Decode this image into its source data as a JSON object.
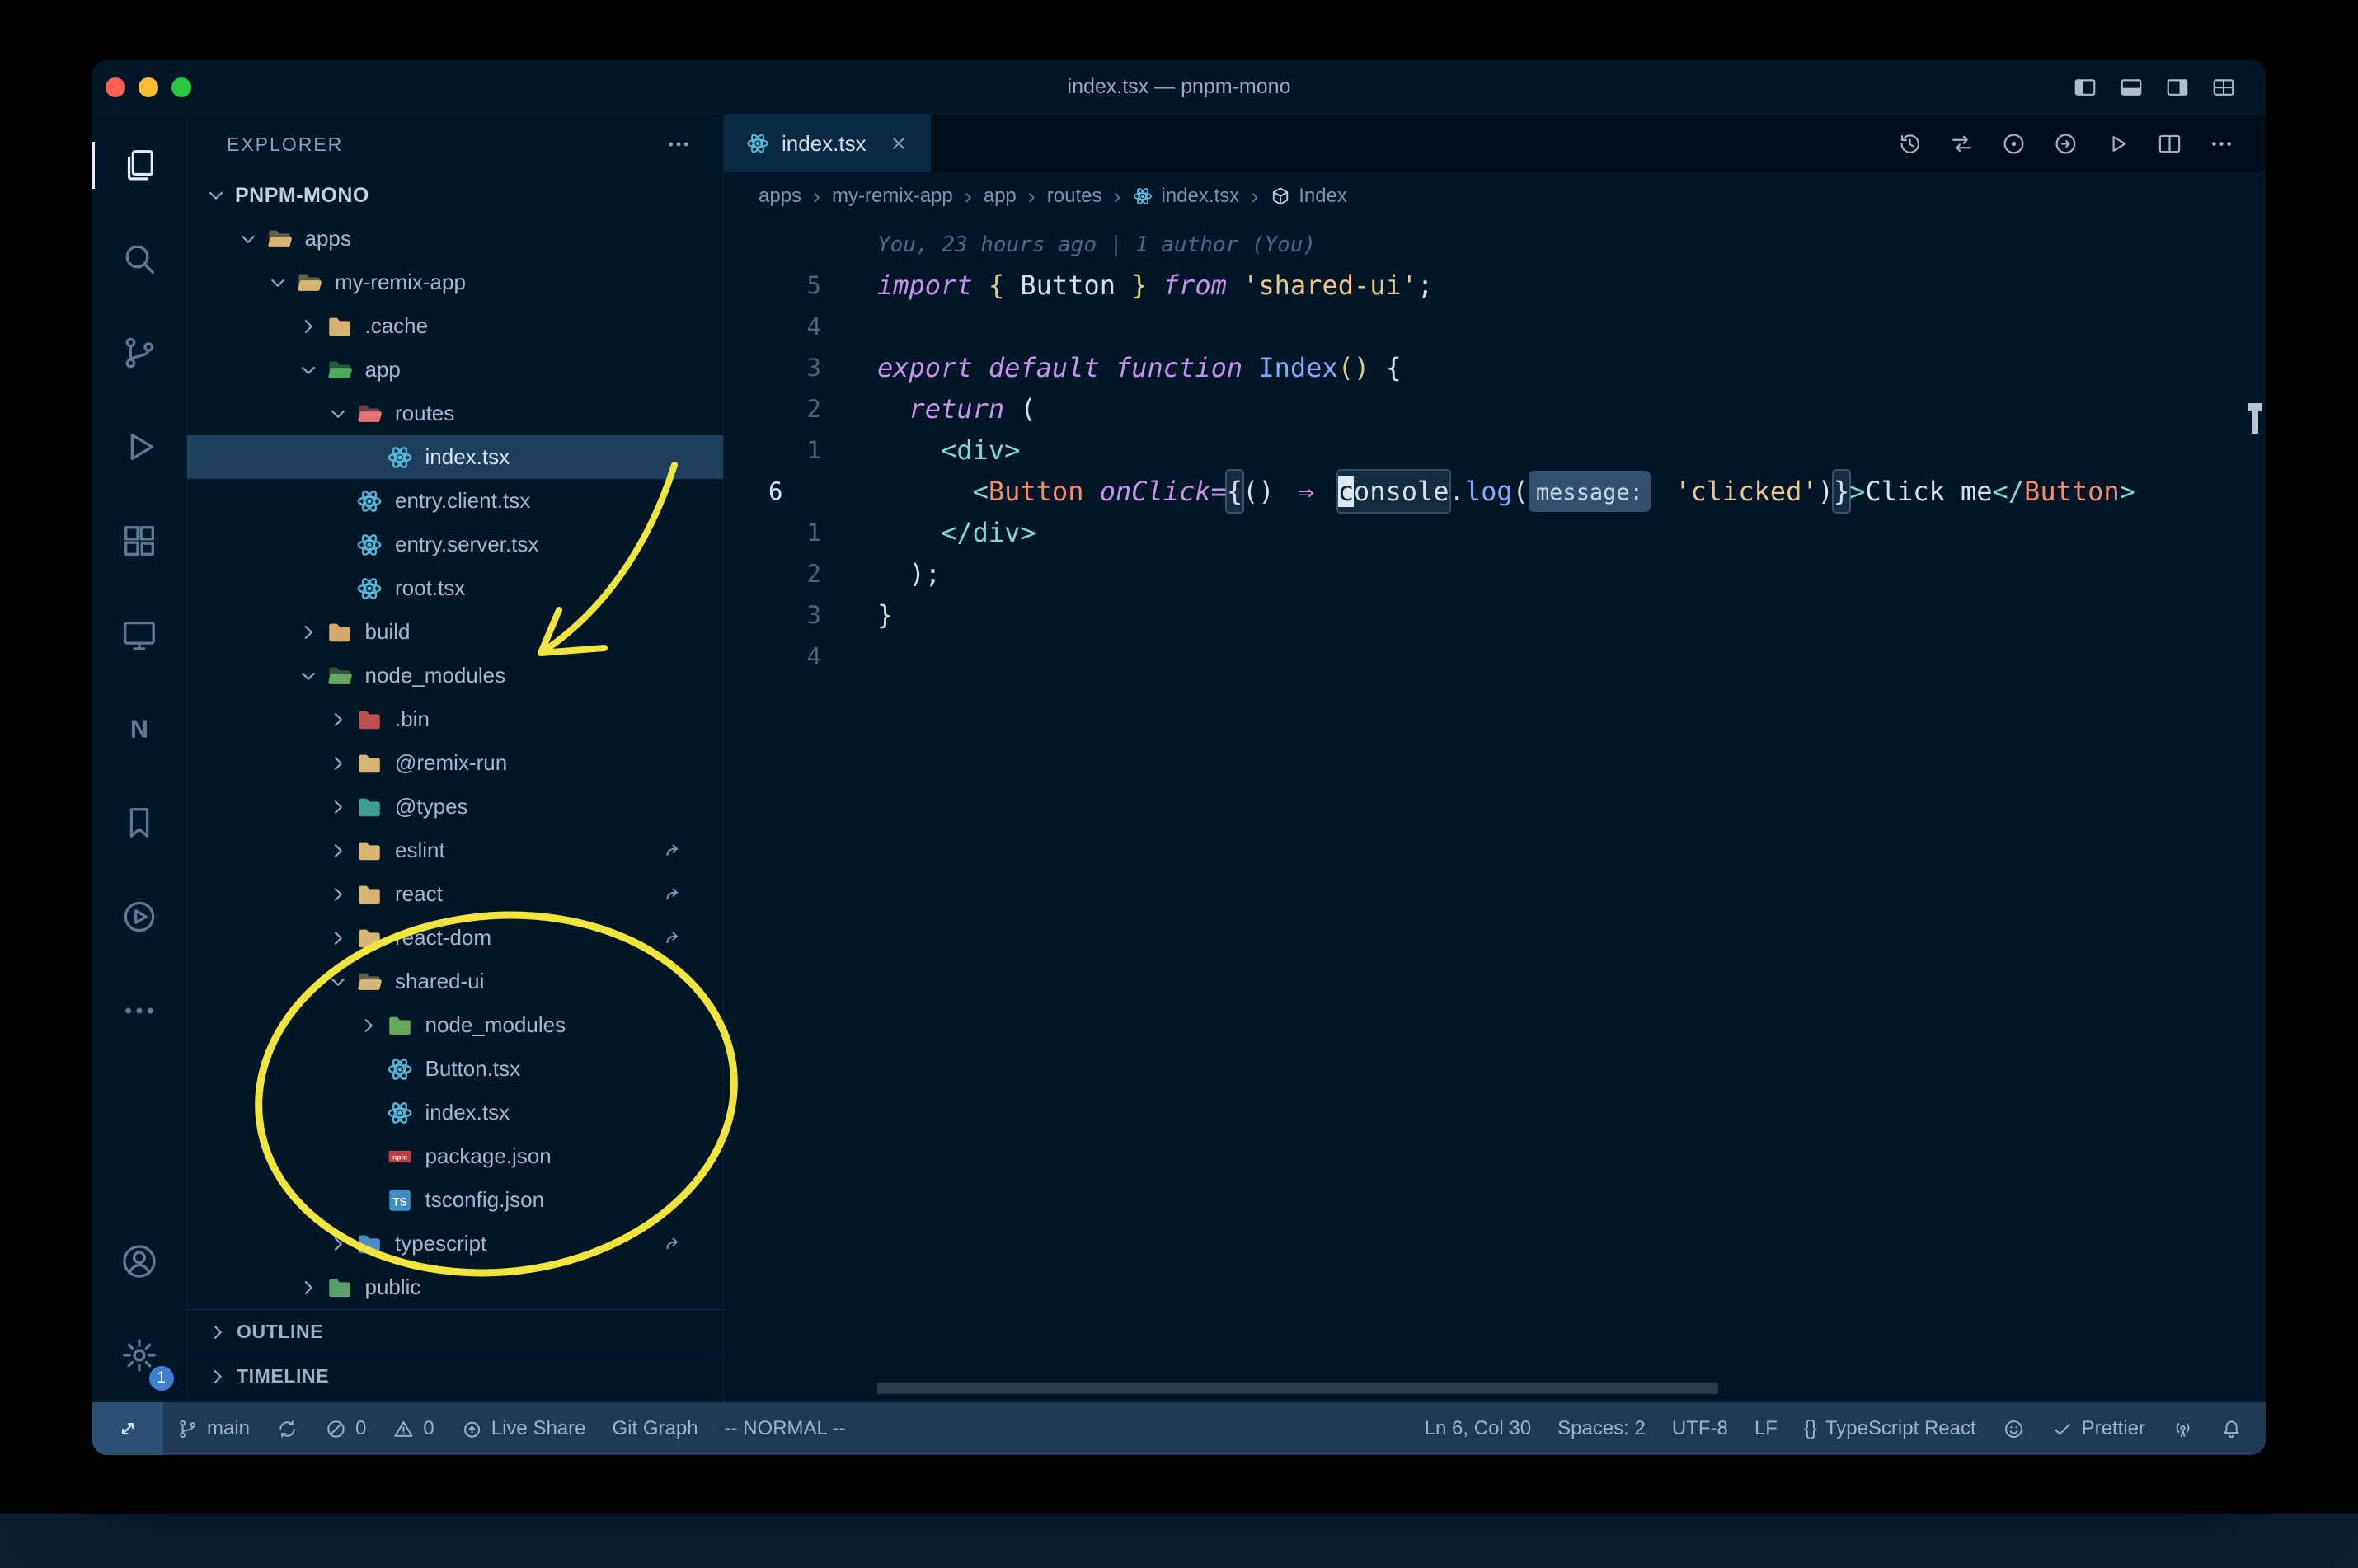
{
  "colors": {
    "yellow_annotation": "#f1e43c",
    "selection": "#1d3f5c",
    "statusbar_bg": "#1f3a55",
    "badge": "#3f7fd4",
    "react_icon": "#56b6d9"
  },
  "window": {
    "title": "index.tsx — pnpm-mono",
    "controls": [
      {
        "name": "close",
        "color": "#ff5f57"
      },
      {
        "name": "minimize",
        "color": "#febc2e"
      },
      {
        "name": "zoom",
        "color": "#28c840"
      }
    ]
  },
  "titlebar": {
    "layout_icons": [
      {
        "name": "toggle-primary-sidebar",
        "icon": "layout-left"
      },
      {
        "name": "toggle-panel",
        "icon": "layout-bottom"
      },
      {
        "name": "toggle-secondary-sidebar",
        "icon": "layout-right"
      },
      {
        "name": "customize-layout",
        "icon": "layout-grid"
      }
    ]
  },
  "activity_bar": {
    "top": [
      {
        "name": "explorer",
        "icon": "files",
        "active": true
      },
      {
        "name": "search",
        "icon": "search"
      },
      {
        "name": "source-control",
        "icon": "scm"
      },
      {
        "name": "run-and-debug",
        "icon": "debug"
      },
      {
        "name": "extensions",
        "icon": "extensions"
      },
      {
        "name": "remote-explorer",
        "icon": "monitor"
      },
      {
        "name": "nx-console",
        "icon": "nx"
      },
      {
        "name": "bookmarks",
        "icon": "bookmark"
      },
      {
        "name": "code-runner",
        "icon": "runner"
      },
      {
        "name": "additional-views",
        "icon": "more"
      }
    ],
    "bottom": [
      {
        "name": "accounts",
        "icon": "account"
      },
      {
        "name": "settings",
        "icon": "gear",
        "badge": "1"
      }
    ]
  },
  "sidebar": {
    "header": "EXPLORER",
    "root": "PNPM-MONO",
    "tree": [
      {
        "label": "apps",
        "level": 1,
        "chev": "down",
        "icon": "folder-open",
        "color": "#d8b573"
      },
      {
        "label": "my-remix-app",
        "level": 2,
        "chev": "down",
        "icon": "folder-open",
        "color": "#d8b573"
      },
      {
        "label": ".cache",
        "level": 3,
        "chev": "right",
        "icon": "folder",
        "color": "#d8b573"
      },
      {
        "label": "app",
        "level": 3,
        "chev": "down",
        "icon": "folder-open",
        "color": "#4fab5c"
      },
      {
        "label": "routes",
        "level": 4,
        "chev": "down",
        "icon": "folder-open",
        "color": "#e57373"
      },
      {
        "label": "index.tsx",
        "level": 5,
        "icon": "react",
        "selected": true
      },
      {
        "label": "entry.client.tsx",
        "level": 4,
        "icon": "react"
      },
      {
        "label": "entry.server.tsx",
        "level": 4,
        "icon": "react"
      },
      {
        "label": "root.tsx",
        "level": 4,
        "icon": "react"
      },
      {
        "label": "build",
        "level": 3,
        "chev": "right",
        "icon": "folder",
        "color": "#d8a86a"
      },
      {
        "label": "node_modules",
        "level": 3,
        "chev": "down",
        "icon": "folder-open",
        "color": "#66a95c"
      },
      {
        "label": ".bin",
        "level": 4,
        "chev": "right",
        "icon": "folder",
        "color": "#c05050"
      },
      {
        "label": "@remix-run",
        "level": 4,
        "chev": "right",
        "icon": "folder",
        "color": "#d8b573"
      },
      {
        "label": "@types",
        "level": 4,
        "chev": "right",
        "icon": "folder",
        "color": "#3e9e8f"
      },
      {
        "label": "eslint",
        "level": 4,
        "chev": "right",
        "icon": "folder",
        "color": "#d8b573",
        "symlink": true
      },
      {
        "label": "react",
        "level": 4,
        "chev": "right",
        "icon": "folder",
        "color": "#d8b573",
        "symlink": true
      },
      {
        "label": "react-dom",
        "level": 4,
        "chev": "right",
        "icon": "folder",
        "color": "#d8b573",
        "symlink": true
      },
      {
        "label": "shared-ui",
        "level": 4,
        "chev": "down",
        "icon": "folder-open",
        "color": "#d8b573"
      },
      {
        "label": "node_modules",
        "level": 5,
        "chev": "right",
        "icon": "folder",
        "color": "#66a95c"
      },
      {
        "label": "Button.tsx",
        "level": 5,
        "icon": "react"
      },
      {
        "label": "index.tsx",
        "level": 5,
        "icon": "react"
      },
      {
        "label": "package.json",
        "level": 5,
        "icon": "npm"
      },
      {
        "label": "tsconfig.json",
        "level": 5,
        "icon": "ts"
      },
      {
        "label": "typescript",
        "level": 4,
        "chev": "right",
        "icon": "folder",
        "color": "#4a8fc7",
        "symlink": true
      },
      {
        "label": "public",
        "level": 3,
        "chev": "right",
        "icon": "folder",
        "color": "#5aa06a"
      }
    ],
    "sections": [
      "OUTLINE",
      "TIMELINE"
    ]
  },
  "editor": {
    "tab": {
      "label": "index.tsx"
    },
    "actions": [
      {
        "name": "local-history",
        "icon": "history"
      },
      {
        "name": "open-changes",
        "icon": "compare"
      },
      {
        "name": "toggle-blame",
        "icon": "circle-dot"
      },
      {
        "name": "open-preview",
        "icon": "circle-arrow"
      },
      {
        "name": "run-file",
        "icon": "play"
      },
      {
        "name": "split-editor",
        "icon": "split"
      },
      {
        "name": "more-actions",
        "icon": "moreh"
      }
    ],
    "breadcrumbs": [
      {
        "label": "apps"
      },
      {
        "label": "my-remix-app"
      },
      {
        "label": "app"
      },
      {
        "label": "routes"
      },
      {
        "label": "index.tsx",
        "icon": "react"
      },
      {
        "label": "Index",
        "icon": "symbol"
      }
    ],
    "blame": "You, 23 hours ago | 1 author (You)",
    "lines": [
      {
        "num": "5",
        "tokens": [
          {
            "t": "import",
            "c": "kw"
          },
          {
            "t": " ",
            "c": "fg"
          },
          {
            "t": "{",
            "c": "gold"
          },
          {
            "t": " Button ",
            "c": "fg"
          },
          {
            "t": "}",
            "c": "gold"
          },
          {
            "t": " ",
            "c": "fg"
          },
          {
            "t": "from",
            "c": "kw"
          },
          {
            "t": " ",
            "c": "fg"
          },
          {
            "t": "'shared-ui'",
            "c": "str"
          },
          {
            "t": ";",
            "c": "fg"
          }
        ]
      },
      {
        "num": "4",
        "tokens": []
      },
      {
        "num": "3",
        "tokens": [
          {
            "t": "export",
            "c": "kw"
          },
          {
            "t": " ",
            "c": "fg"
          },
          {
            "t": "default",
            "c": "kw"
          },
          {
            "t": " ",
            "c": "fg"
          },
          {
            "t": "function",
            "c": "kw"
          },
          {
            "t": " ",
            "c": "fg"
          },
          {
            "t": "Index",
            "c": "fn"
          },
          {
            "t": "()",
            "c": "gold"
          },
          {
            "t": " {",
            "c": "fg"
          }
        ]
      },
      {
        "num": "2",
        "tokens": [
          {
            "t": "  ",
            "c": "fg"
          },
          {
            "t": "return",
            "c": "kw"
          },
          {
            "t": " (",
            "c": "fg"
          }
        ]
      },
      {
        "num": "1",
        "tokens": [
          {
            "t": "    ",
            "c": "fg"
          },
          {
            "t": "<div>",
            "c": "tag"
          }
        ]
      },
      {
        "num": "6",
        "cur": true,
        "tokens": [
          {
            "t": "      ",
            "c": "fg"
          },
          {
            "t": "<",
            "c": "tag"
          },
          {
            "t": "Button",
            "c": "cmp"
          },
          {
            "t": " ",
            "c": "fg"
          },
          {
            "t": "onClick",
            "c": "attr"
          },
          {
            "t": "=",
            "c": "kw"
          },
          {
            "t": "{",
            "c": "brk"
          },
          {
            "t": "()",
            "c": "fg"
          },
          {
            "t": " ",
            "c": "fg"
          },
          {
            "t": "⇒",
            "c": "lig"
          },
          {
            "t": " ",
            "c": "fg"
          },
          {
            "t": "console",
            "c": "whl",
            "cursor": 0
          },
          {
            "t": ".",
            "c": "fg"
          },
          {
            "t": "log",
            "c": "fn"
          },
          {
            "t": "(",
            "c": "fg"
          },
          {
            "t": "message:",
            "c": "inlay"
          },
          {
            "t": " ",
            "c": "fg"
          },
          {
            "t": "'clicked'",
            "c": "str"
          },
          {
            "t": ")",
            "c": "fg"
          },
          {
            "t": "}",
            "c": "brk"
          },
          {
            "t": ">",
            "c": "tag"
          },
          {
            "t": "Click me",
            "c": "fg"
          },
          {
            "t": "</",
            "c": "tag"
          },
          {
            "t": "Button",
            "c": "cmp"
          },
          {
            "t": ">",
            "c": "tag"
          }
        ]
      },
      {
        "num": "1",
        "tokens": [
          {
            "t": "    ",
            "c": "fg"
          },
          {
            "t": "</div>",
            "c": "tag"
          }
        ]
      },
      {
        "num": "2",
        "tokens": [
          {
            "t": "  ",
            "c": "fg"
          },
          {
            "t": ");",
            "c": "fg"
          }
        ]
      },
      {
        "num": "3",
        "tokens": [
          {
            "t": "}",
            "c": "fg"
          }
        ]
      },
      {
        "num": "4",
        "tokens": []
      }
    ]
  },
  "status_bar": {
    "left": [
      {
        "name": "remote",
        "icon": "remote",
        "box": true
      },
      {
        "name": "branch",
        "icon": "branch",
        "label": "main"
      },
      {
        "name": "sync",
        "icon": "sync"
      },
      {
        "name": "errors",
        "icon": "error",
        "label": "0"
      },
      {
        "name": "warnings",
        "icon": "warning",
        "label": "0"
      },
      {
        "name": "live-share",
        "icon": "liveshare",
        "label": "Live Share"
      },
      {
        "name": "git-graph",
        "label": "Git Graph"
      },
      {
        "name": "vim-mode",
        "label": "-- NORMAL --"
      }
    ],
    "right": [
      {
        "name": "cursor-position",
        "label": "Ln 6, Col 30"
      },
      {
        "name": "indentation",
        "label": "Spaces: 2"
      },
      {
        "name": "encoding",
        "label": "UTF-8"
      },
      {
        "name": "eol",
        "label": "LF"
      },
      {
        "name": "language-mode",
        "icon": "braces",
        "label": "TypeScript React"
      },
      {
        "name": "feedback",
        "icon": "smiley"
      },
      {
        "name": "prettier",
        "icon": "check",
        "label": "Prettier"
      },
      {
        "name": "broadcast",
        "icon": "radio"
      },
      {
        "name": "notifications",
        "icon": "bell"
      }
    ]
  }
}
